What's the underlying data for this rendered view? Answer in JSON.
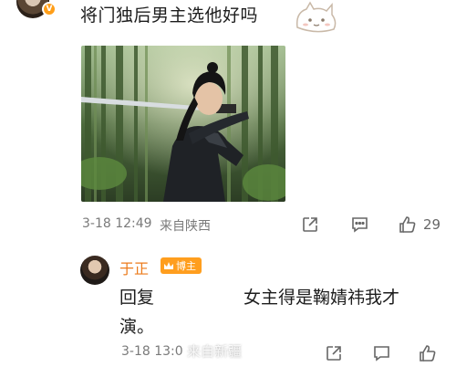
{
  "comment": {
    "text": "将门独后男主选他好吗",
    "meta": {
      "date_time": "3-18 12:49",
      "source": "来自陕西"
    },
    "actions": {
      "share_icon": "share-icon",
      "comment_icon": "comment-icon",
      "like_icon": "thumbs-up-icon",
      "like_count": "29"
    }
  },
  "reply": {
    "author": "于正",
    "badge_label": "博主",
    "reply_prefix": "回复",
    "text": "女主得是鞠婧祎我才演。",
    "meta": {
      "date_time": "3-18 13:0",
      "source": "来自新疆"
    },
    "actions": {
      "share_icon": "share-icon",
      "comment_icon": "comment-icon",
      "like_icon": "thumbs-up-icon"
    }
  },
  "watermark": "来自新疆",
  "colors": {
    "author_orange": "#ec7b1c",
    "badge_orange": "#ff9e1e",
    "meta_gray": "#7a7a7a"
  }
}
